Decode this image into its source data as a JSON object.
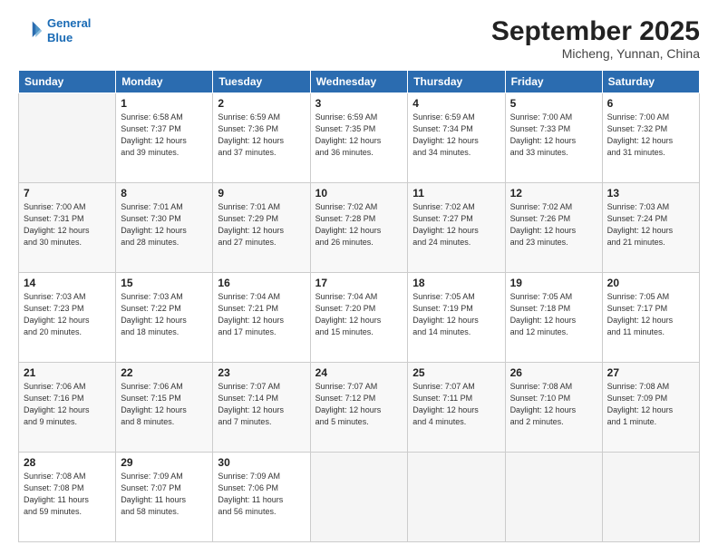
{
  "header": {
    "logo_line1": "General",
    "logo_line2": "Blue",
    "month": "September 2025",
    "location": "Micheng, Yunnan, China"
  },
  "weekdays": [
    "Sunday",
    "Monday",
    "Tuesday",
    "Wednesday",
    "Thursday",
    "Friday",
    "Saturday"
  ],
  "weeks": [
    [
      {
        "day": "",
        "info": ""
      },
      {
        "day": "1",
        "info": "Sunrise: 6:58 AM\nSunset: 7:37 PM\nDaylight: 12 hours\nand 39 minutes."
      },
      {
        "day": "2",
        "info": "Sunrise: 6:59 AM\nSunset: 7:36 PM\nDaylight: 12 hours\nand 37 minutes."
      },
      {
        "day": "3",
        "info": "Sunrise: 6:59 AM\nSunset: 7:35 PM\nDaylight: 12 hours\nand 36 minutes."
      },
      {
        "day": "4",
        "info": "Sunrise: 6:59 AM\nSunset: 7:34 PM\nDaylight: 12 hours\nand 34 minutes."
      },
      {
        "day": "5",
        "info": "Sunrise: 7:00 AM\nSunset: 7:33 PM\nDaylight: 12 hours\nand 33 minutes."
      },
      {
        "day": "6",
        "info": "Sunrise: 7:00 AM\nSunset: 7:32 PM\nDaylight: 12 hours\nand 31 minutes."
      }
    ],
    [
      {
        "day": "7",
        "info": "Sunrise: 7:00 AM\nSunset: 7:31 PM\nDaylight: 12 hours\nand 30 minutes."
      },
      {
        "day": "8",
        "info": "Sunrise: 7:01 AM\nSunset: 7:30 PM\nDaylight: 12 hours\nand 28 minutes."
      },
      {
        "day": "9",
        "info": "Sunrise: 7:01 AM\nSunset: 7:29 PM\nDaylight: 12 hours\nand 27 minutes."
      },
      {
        "day": "10",
        "info": "Sunrise: 7:02 AM\nSunset: 7:28 PM\nDaylight: 12 hours\nand 26 minutes."
      },
      {
        "day": "11",
        "info": "Sunrise: 7:02 AM\nSunset: 7:27 PM\nDaylight: 12 hours\nand 24 minutes."
      },
      {
        "day": "12",
        "info": "Sunrise: 7:02 AM\nSunset: 7:26 PM\nDaylight: 12 hours\nand 23 minutes."
      },
      {
        "day": "13",
        "info": "Sunrise: 7:03 AM\nSunset: 7:24 PM\nDaylight: 12 hours\nand 21 minutes."
      }
    ],
    [
      {
        "day": "14",
        "info": "Sunrise: 7:03 AM\nSunset: 7:23 PM\nDaylight: 12 hours\nand 20 minutes."
      },
      {
        "day": "15",
        "info": "Sunrise: 7:03 AM\nSunset: 7:22 PM\nDaylight: 12 hours\nand 18 minutes."
      },
      {
        "day": "16",
        "info": "Sunrise: 7:04 AM\nSunset: 7:21 PM\nDaylight: 12 hours\nand 17 minutes."
      },
      {
        "day": "17",
        "info": "Sunrise: 7:04 AM\nSunset: 7:20 PM\nDaylight: 12 hours\nand 15 minutes."
      },
      {
        "day": "18",
        "info": "Sunrise: 7:05 AM\nSunset: 7:19 PM\nDaylight: 12 hours\nand 14 minutes."
      },
      {
        "day": "19",
        "info": "Sunrise: 7:05 AM\nSunset: 7:18 PM\nDaylight: 12 hours\nand 12 minutes."
      },
      {
        "day": "20",
        "info": "Sunrise: 7:05 AM\nSunset: 7:17 PM\nDaylight: 12 hours\nand 11 minutes."
      }
    ],
    [
      {
        "day": "21",
        "info": "Sunrise: 7:06 AM\nSunset: 7:16 PM\nDaylight: 12 hours\nand 9 minutes."
      },
      {
        "day": "22",
        "info": "Sunrise: 7:06 AM\nSunset: 7:15 PM\nDaylight: 12 hours\nand 8 minutes."
      },
      {
        "day": "23",
        "info": "Sunrise: 7:07 AM\nSunset: 7:14 PM\nDaylight: 12 hours\nand 7 minutes."
      },
      {
        "day": "24",
        "info": "Sunrise: 7:07 AM\nSunset: 7:12 PM\nDaylight: 12 hours\nand 5 minutes."
      },
      {
        "day": "25",
        "info": "Sunrise: 7:07 AM\nSunset: 7:11 PM\nDaylight: 12 hours\nand 4 minutes."
      },
      {
        "day": "26",
        "info": "Sunrise: 7:08 AM\nSunset: 7:10 PM\nDaylight: 12 hours\nand 2 minutes."
      },
      {
        "day": "27",
        "info": "Sunrise: 7:08 AM\nSunset: 7:09 PM\nDaylight: 12 hours\nand 1 minute."
      }
    ],
    [
      {
        "day": "28",
        "info": "Sunrise: 7:08 AM\nSunset: 7:08 PM\nDaylight: 11 hours\nand 59 minutes."
      },
      {
        "day": "29",
        "info": "Sunrise: 7:09 AM\nSunset: 7:07 PM\nDaylight: 11 hours\nand 58 minutes."
      },
      {
        "day": "30",
        "info": "Sunrise: 7:09 AM\nSunset: 7:06 PM\nDaylight: 11 hours\nand 56 minutes."
      },
      {
        "day": "",
        "info": ""
      },
      {
        "day": "",
        "info": ""
      },
      {
        "day": "",
        "info": ""
      },
      {
        "day": "",
        "info": ""
      }
    ]
  ]
}
